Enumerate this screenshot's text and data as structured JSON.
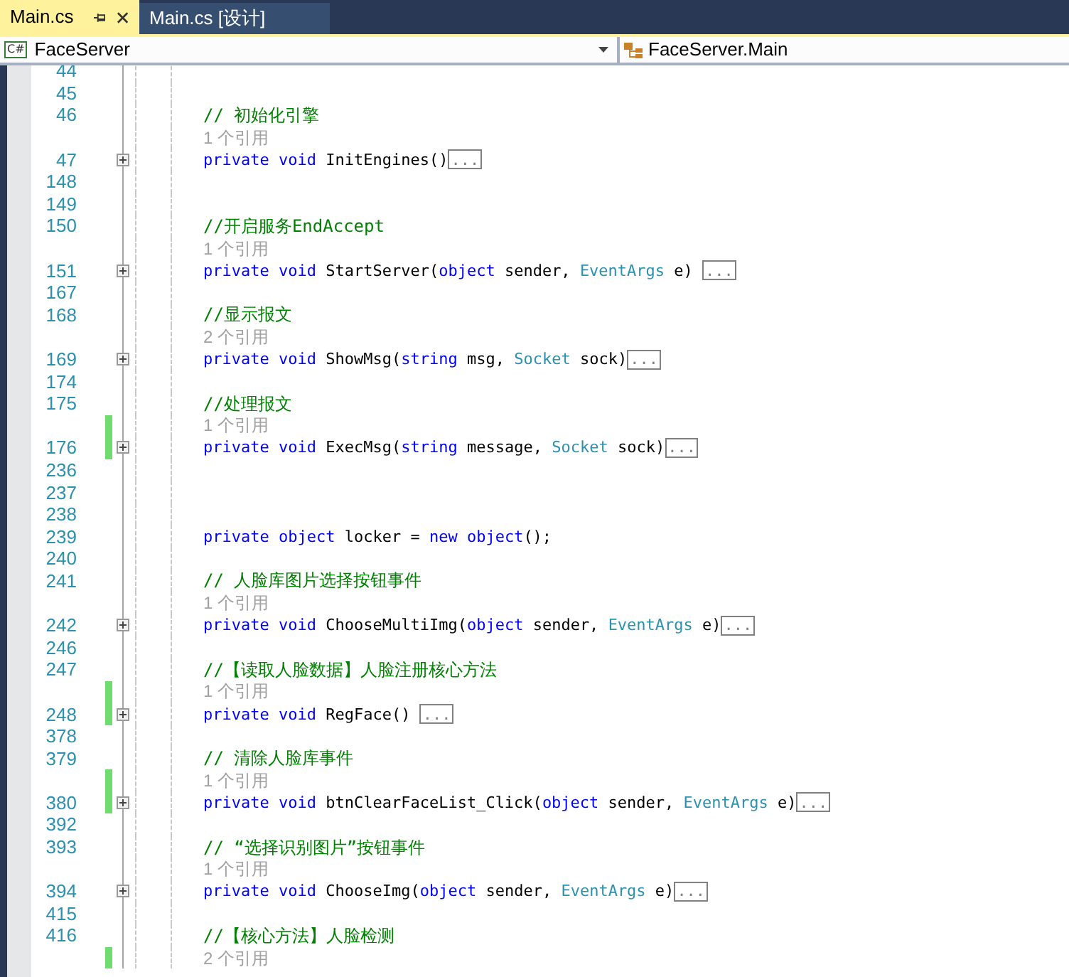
{
  "tabs": [
    {
      "label": "Main.cs",
      "selected": true
    },
    {
      "label": "Main.cs [设计]",
      "selected": false
    }
  ],
  "navigation": {
    "language_badge": "C#",
    "project": "FaceServer",
    "member": "FaceServer.Main"
  },
  "lines": [
    {
      "kind": "blank",
      "number": "44"
    },
    {
      "kind": "blank",
      "number": "45"
    },
    {
      "kind": "comment",
      "number": "46",
      "text": "// 初始化引擎"
    },
    {
      "kind": "lens",
      "text": "1 个引用"
    },
    {
      "kind": "code",
      "number": "47",
      "changed": false,
      "collapsed": true,
      "ellipsis": "...",
      "tokens": [
        {
          "text": "private",
          "kind": "keyword"
        },
        {
          "text": " void",
          "kind": "keyword"
        },
        {
          "text": " InitEngines()",
          "kind": "plain"
        }
      ]
    },
    {
      "kind": "blank",
      "number": "148"
    },
    {
      "kind": "blank",
      "number": "149"
    },
    {
      "kind": "comment",
      "number": "150",
      "text": "//开启服务EndAccept"
    },
    {
      "kind": "lens",
      "text": "1 个引用"
    },
    {
      "kind": "code",
      "number": "151",
      "changed": false,
      "collapsed": true,
      "ellipsis": "...",
      "tokens": [
        {
          "text": "private",
          "kind": "keyword"
        },
        {
          "text": " void",
          "kind": "keyword"
        },
        {
          "text": " StartServer(",
          "kind": "plain"
        },
        {
          "text": "object",
          "kind": "keyword"
        },
        {
          "text": " sender, ",
          "kind": "plain"
        },
        {
          "text": "EventArgs",
          "kind": "type"
        },
        {
          "text": " e) ",
          "kind": "plain"
        }
      ]
    },
    {
      "kind": "blank",
      "number": "167"
    },
    {
      "kind": "comment",
      "number": "168",
      "text": "//显示报文"
    },
    {
      "kind": "lens",
      "text": "2 个引用"
    },
    {
      "kind": "code",
      "number": "169",
      "changed": false,
      "collapsed": true,
      "ellipsis": "...",
      "tokens": [
        {
          "text": "private",
          "kind": "keyword"
        },
        {
          "text": " void",
          "kind": "keyword"
        },
        {
          "text": " ShowMsg(",
          "kind": "plain"
        },
        {
          "text": "string",
          "kind": "keyword"
        },
        {
          "text": " msg, ",
          "kind": "plain"
        },
        {
          "text": "Socket",
          "kind": "type"
        },
        {
          "text": " sock)",
          "kind": "plain"
        }
      ]
    },
    {
      "kind": "blank",
      "number": "174"
    },
    {
      "kind": "comment",
      "number": "175",
      "text": "//处理报文"
    },
    {
      "kind": "lens",
      "text": "1 个引用",
      "changed": true
    },
    {
      "kind": "code",
      "number": "176",
      "changed": true,
      "collapsed": true,
      "ellipsis": "...",
      "tokens": [
        {
          "text": "private",
          "kind": "keyword"
        },
        {
          "text": " void",
          "kind": "keyword"
        },
        {
          "text": " ExecMsg(",
          "kind": "plain"
        },
        {
          "text": "string",
          "kind": "keyword"
        },
        {
          "text": " message, ",
          "kind": "plain"
        },
        {
          "text": "Socket",
          "kind": "type"
        },
        {
          "text": " sock)",
          "kind": "plain"
        }
      ]
    },
    {
      "kind": "blank",
      "number": "236"
    },
    {
      "kind": "blank",
      "number": "237"
    },
    {
      "kind": "blank",
      "number": "238"
    },
    {
      "kind": "code",
      "number": "239",
      "changed": false,
      "collapsed": false,
      "tokens": [
        {
          "text": "private",
          "kind": "keyword"
        },
        {
          "text": " object",
          "kind": "keyword"
        },
        {
          "text": " locker = ",
          "kind": "plain"
        },
        {
          "text": "new",
          "kind": "keyword"
        },
        {
          "text": " object",
          "kind": "keyword"
        },
        {
          "text": "();",
          "kind": "plain"
        }
      ]
    },
    {
      "kind": "blank",
      "number": "240"
    },
    {
      "kind": "comment",
      "number": "241",
      "text": "// 人脸库图片选择按钮事件"
    },
    {
      "kind": "lens",
      "text": "1 个引用"
    },
    {
      "kind": "code",
      "number": "242",
      "changed": false,
      "collapsed": true,
      "ellipsis": "...",
      "tokens": [
        {
          "text": "private",
          "kind": "keyword"
        },
        {
          "text": " void",
          "kind": "keyword"
        },
        {
          "text": " ChooseMultiImg(",
          "kind": "plain"
        },
        {
          "text": "object",
          "kind": "keyword"
        },
        {
          "text": " sender, ",
          "kind": "plain"
        },
        {
          "text": "EventArgs",
          "kind": "type"
        },
        {
          "text": " e)",
          "kind": "plain"
        }
      ]
    },
    {
      "kind": "blank",
      "number": "246"
    },
    {
      "kind": "comment",
      "number": "247",
      "text": "//【读取人脸数据】人脸注册核心方法"
    },
    {
      "kind": "lens",
      "text": "1 个引用",
      "changed": true
    },
    {
      "kind": "code",
      "number": "248",
      "changed": true,
      "collapsed": true,
      "ellipsis": "...",
      "tokens": [
        {
          "text": "private",
          "kind": "keyword"
        },
        {
          "text": " void",
          "kind": "keyword"
        },
        {
          "text": " RegFace() ",
          "kind": "plain"
        }
      ]
    },
    {
      "kind": "blank",
      "number": "378"
    },
    {
      "kind": "comment",
      "number": "379",
      "text": "// 清除人脸库事件"
    },
    {
      "kind": "lens",
      "text": "1 个引用",
      "changed": true
    },
    {
      "kind": "code",
      "number": "380",
      "changed": true,
      "collapsed": true,
      "ellipsis": "...",
      "tokens": [
        {
          "text": "private",
          "kind": "keyword"
        },
        {
          "text": " void",
          "kind": "keyword"
        },
        {
          "text": " btnClearFaceList_Click(",
          "kind": "plain"
        },
        {
          "text": "object",
          "kind": "keyword"
        },
        {
          "text": " sender, ",
          "kind": "plain"
        },
        {
          "text": "EventArgs",
          "kind": "type"
        },
        {
          "text": " e)",
          "kind": "plain"
        }
      ]
    },
    {
      "kind": "blank",
      "number": "392"
    },
    {
      "kind": "comment",
      "number": "393",
      "text": "// “选择识别图片”按钮事件"
    },
    {
      "kind": "lens",
      "text": "1 个引用"
    },
    {
      "kind": "code",
      "number": "394",
      "changed": false,
      "collapsed": true,
      "ellipsis": "...",
      "tokens": [
        {
          "text": "private",
          "kind": "keyword"
        },
        {
          "text": " void",
          "kind": "keyword"
        },
        {
          "text": " ChooseImg(",
          "kind": "plain"
        },
        {
          "text": "object",
          "kind": "keyword"
        },
        {
          "text": " sender, ",
          "kind": "plain"
        },
        {
          "text": "EventArgs",
          "kind": "type"
        },
        {
          "text": " e)",
          "kind": "plain"
        }
      ]
    },
    {
      "kind": "blank",
      "number": "415"
    },
    {
      "kind": "comment",
      "number": "416",
      "text": "//【核心方法】人脸检测"
    },
    {
      "kind": "lens",
      "text": "2 个引用",
      "changed": true
    }
  ]
}
